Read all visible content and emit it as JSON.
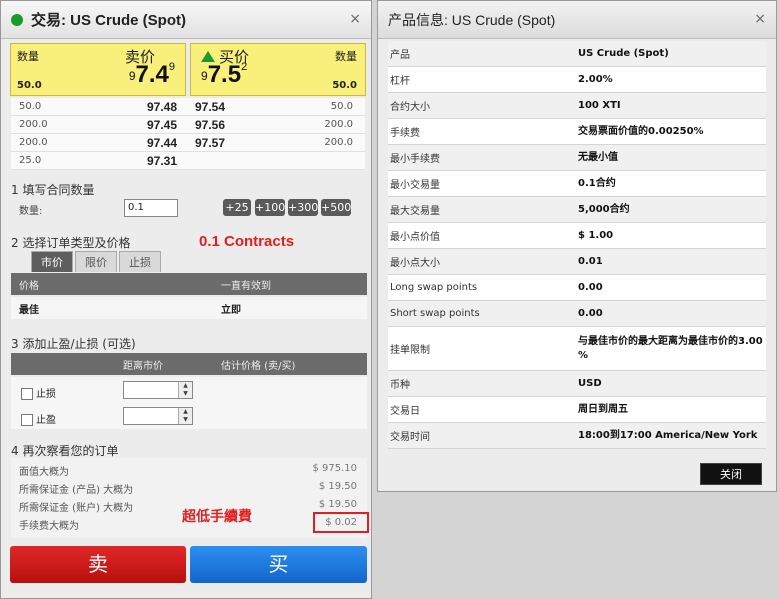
{
  "trade": {
    "title": "交易: US Crude (Spot)",
    "close_glyph": "×",
    "sell_quote": {
      "qty_label": "数量",
      "title": "卖价",
      "price_a": "9",
      "price_b": "7.4",
      "price_c": "9",
      "qty": "50.0"
    },
    "buy_quote": {
      "qty_label": "数量",
      "title": "买价",
      "price_a": "9",
      "price_b": "7.5",
      "price_c": "2",
      "qty": "50.0"
    },
    "depth": [
      {
        "sell_qty": "50.0",
        "sell_price": "97.48",
        "buy_price": "97.54",
        "buy_qty": "50.0"
      },
      {
        "sell_qty": "200.0",
        "sell_price": "97.45",
        "buy_price": "97.56",
        "buy_qty": "200.0"
      },
      {
        "sell_qty": "200.0",
        "sell_price": "97.44",
        "buy_price": "97.57",
        "buy_qty": "200.0"
      },
      {
        "sell_qty": "25.0",
        "sell_price": "97.31",
        "buy_price": "",
        "buy_qty": ""
      }
    ],
    "step1": {
      "heading": "1 填写合同数量",
      "qty_label": "数量:",
      "qty_value": "0.1",
      "buttons": [
        "+25",
        "+100",
        "+300",
        "+500"
      ]
    },
    "annotation_contracts": "0.1 Contracts",
    "step2": {
      "heading": "2 选择订单类型及价格",
      "tabs": [
        "市价",
        "限价",
        "止损"
      ],
      "col_price": "价格",
      "col_validity": "一直有效到",
      "price_value": "最佳",
      "validity_value": "立即"
    },
    "step3": {
      "heading": "3 添加止盈/止损 (可选)",
      "col_distance": "距离市价",
      "col_est": "估计价格 (卖/买)",
      "stop_loss": "止损",
      "take_profit": "止盈"
    },
    "step4": {
      "heading": "4 再次察看您的订单",
      "rows": [
        {
          "label": "面值大概为",
          "value": "$ 975.10"
        },
        {
          "label": "所需保证金 (产品) 大概为",
          "value": "$ 19.50"
        },
        {
          "label": "所需保证金 (账户) 大概为",
          "value": "$ 19.50"
        },
        {
          "label": "手续费大概为",
          "value": "$ 0.02"
        }
      ]
    },
    "annotation_fee": "超低手續費",
    "sell_label": "卖",
    "buy_label": "买"
  },
  "info": {
    "title": "产品信息: US Crude (Spot)",
    "close_glyph": "×",
    "rows": [
      {
        "key": "产品",
        "value": "US Crude (Spot)"
      },
      {
        "key": "杠杆",
        "value": "2.00%"
      },
      {
        "key": "合约大小",
        "value": "100 XTI"
      },
      {
        "key": "手续费",
        "value": "交易票面价值的0.00250%"
      },
      {
        "key": "最小手续费",
        "value": "无最小值"
      },
      {
        "key": "最小交易量",
        "value": "0.1合约"
      },
      {
        "key": "最大交易量",
        "value": "5,000合约"
      },
      {
        "key": "最小点价值",
        "value": "$ 1.00"
      },
      {
        "key": "最小点大小",
        "value": "0.01"
      },
      {
        "key": "Long swap points",
        "value": "0.00"
      },
      {
        "key": "Short swap points",
        "value": "0.00"
      },
      {
        "key": "挂单限制",
        "value": "与最佳市价的最大距离为最佳市价的3.00 %"
      },
      {
        "key": "币种",
        "value": "USD"
      },
      {
        "key": "交易日",
        "value": "周日到周五"
      },
      {
        "key": "交易时间",
        "value": "18:00到17:00 America/New York"
      }
    ],
    "close_button": "关闭"
  },
  "colors": {
    "sell": "#c81818",
    "buy": "#1f7be0",
    "quote_bg": "#f8f07a",
    "up_arrow": "#1a9a2e",
    "annotation": "#e02020"
  }
}
